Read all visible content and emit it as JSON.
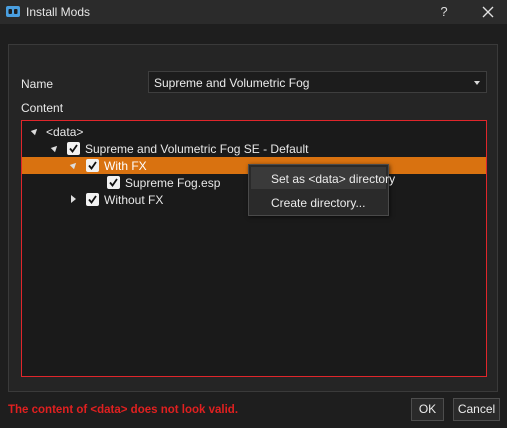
{
  "window": {
    "title": "Install Mods",
    "help_label": "?",
    "accent_color": "#d97210",
    "error_color": "#e02020"
  },
  "form": {
    "name_label": "Name",
    "name_value": "Supreme and Volumetric Fog",
    "content_label": "Content"
  },
  "tree": {
    "items": [
      {
        "label": "<data>",
        "expanded": true,
        "checkbox": false,
        "checked": false,
        "selected": false
      },
      {
        "label": "Supreme and Volumetric Fog SE - Default",
        "expanded": true,
        "checkbox": true,
        "checked": true,
        "selected": false
      },
      {
        "label": "With FX",
        "expanded": true,
        "checkbox": true,
        "checked": true,
        "selected": true
      },
      {
        "label": "Supreme Fog.esp",
        "expanded": false,
        "checkbox": true,
        "checked": true,
        "selected": false
      },
      {
        "label": "Without FX",
        "expanded": false,
        "checkbox": true,
        "checked": true,
        "selected": false
      }
    ]
  },
  "context_menu": {
    "items": [
      {
        "label": "Set as <data> directory"
      },
      {
        "label": "Create directory..."
      }
    ]
  },
  "status": {
    "error": "The content of <data> does not look valid."
  },
  "buttons": {
    "ok": "OK",
    "cancel": "Cancel"
  }
}
